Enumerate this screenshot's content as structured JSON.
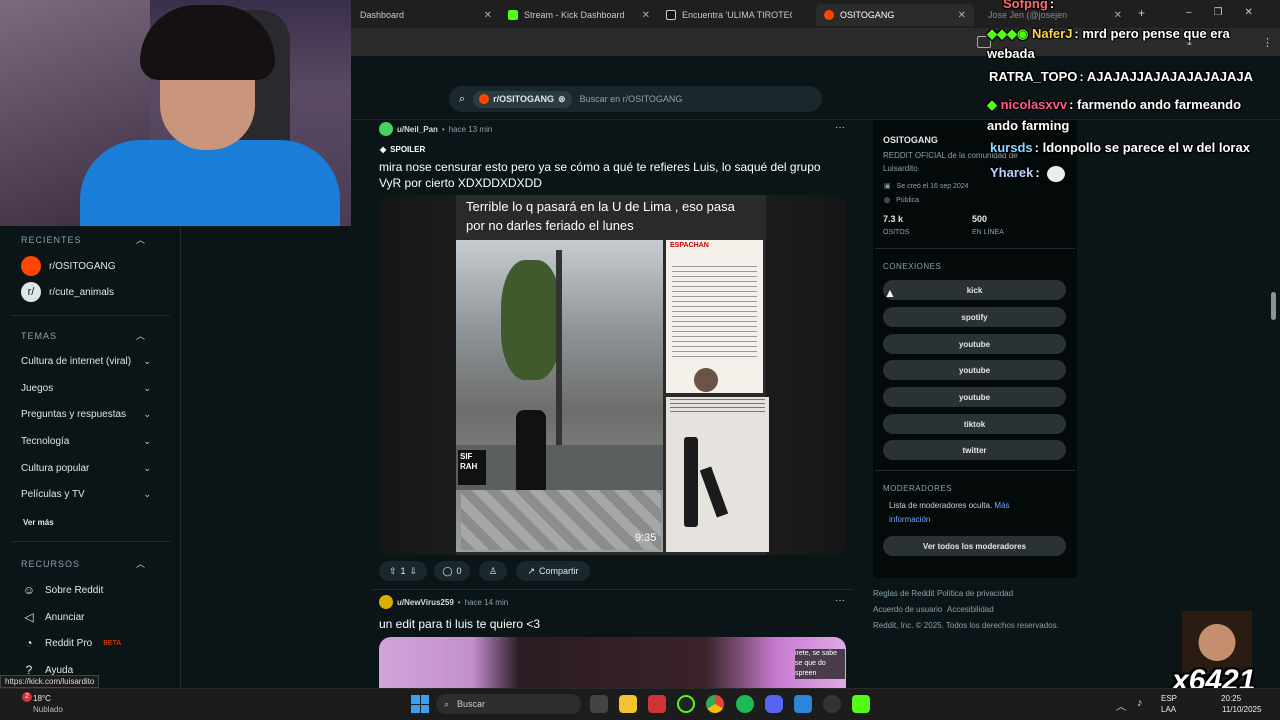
{
  "browser": {
    "tabs": [
      {
        "title": "Dashboard",
        "favicon_color": "#3a3a3a"
      },
      {
        "title": "Stream - Kick Dashboard",
        "favicon_color": "#53fc18"
      },
      {
        "title": "Encuentra 'ULIMA TIROTEO' en",
        "favicon_color": "#111111"
      },
      {
        "title": "OSITOGANG",
        "favicon_color": "#ff4500"
      },
      {
        "title": "Jose Jen (@josejen",
        "favicon_color": "#444444"
      }
    ],
    "new_tab": "+",
    "window_controls": [
      "–",
      "❐",
      "✕"
    ]
  },
  "search": {
    "chip": "r/OSITOGANG",
    "placeholder": "Buscar en r/OSITOGANG"
  },
  "sidebar": {
    "recent_title": "RECIENTES",
    "recent": [
      {
        "label": "r/OSITOGANG",
        "color": "#ff4500"
      },
      {
        "label": "r/cute_animals",
        "color": "#e3e6e8"
      }
    ],
    "topics_title": "TEMAS",
    "topics": [
      "Cultura de internet (viral)",
      "Juegos",
      "Preguntas y respuestas",
      "Tecnología",
      "Cultura popular",
      "Películas y TV"
    ],
    "see_more": "Ver más",
    "resources_title": "RECURSOS",
    "resources": [
      {
        "label": "Sobre Reddit",
        "icon": "reddit-icon"
      },
      {
        "label": "Anunciar",
        "icon": "megaphone-icon"
      },
      {
        "label": "Reddit Pro",
        "icon": "pro-icon",
        "badge": "BETA"
      },
      {
        "label": "Ayuda",
        "icon": "help-icon"
      }
    ]
  },
  "post1": {
    "user": "u/Neil_Pan",
    "time": "hace 13 min",
    "spoiler": "SPOILER",
    "title": "mira nose censurar esto pero ya se cómo a qué te refieres Luis, lo saqué del grupo VyR por cierto XDXDDXDXDD",
    "media_caption": "Terrible lo q pasará en la U de Lima , eso pasa por no darles feriado el lunes",
    "media_time": "9:35",
    "news_header": "ESPACHAN",
    "sign_text": "SIF RAH",
    "votes": "1",
    "comments": "0",
    "share": "Compartir"
  },
  "post2": {
    "user": "u/NewVirus259",
    "time": "hace 14 min",
    "title": "un edit para ti luis te quiero <3",
    "overlay_text": "irete, se sabe se que do spreen"
  },
  "community": {
    "name": "OSITOGANG",
    "description": "REDDIT OFICIAL de la comunidad de Luisardito",
    "created": "Se creó el 16 sep 2024",
    "visibility": "Pública",
    "members_value": "7.3 k",
    "members_label": "OSITOS",
    "online_value": "500",
    "online_label": "EN LÍNEA",
    "connections_title": "CONEXIONES",
    "connections": [
      "kick",
      "spotify",
      "youtube",
      "youtube",
      "youtube",
      "tiktok",
      "twitter"
    ],
    "moderators_title": "MODERADORES",
    "moderators_hidden": "Lista de moderadores oculta.",
    "more_info": "Más información",
    "view_all_mods": "Ver todos los moderadores"
  },
  "footer": {
    "links": [
      "Reglas de Reddit",
      "Política de privacidad",
      "Acuerdo de usuario",
      "Accesibilidad"
    ],
    "copyright": "Reddit, Inc. © 2025. Todos los derechos reservados."
  },
  "chat": [
    {
      "name": "Sofpng",
      "message": ":",
      "color": "#ff6b6b"
    },
    {
      "name": "NaferJ",
      "message": ": mrd pero pense que era webada",
      "color": "#ffd54a"
    },
    {
      "name": "RATRA_TOPO",
      "message": ": AJAJAJJAJAJAJAJAJAJA",
      "color": "#ffffff"
    },
    {
      "name": "nicolasxvv",
      "message": ": farmendo ando farmeando ando farming",
      "color": "#ff5c8a"
    },
    {
      "name": "kursds",
      "message": ": ldonpollo se parece el w del lorax",
      "color": "#8fd6ff"
    },
    {
      "name": "Yharek",
      "message": ":",
      "color": "#bcd2ff"
    }
  ],
  "status_url": "https://kick.com/luisardito",
  "overlay_tag": "x6421",
  "taskbar": {
    "weather_temp": "18°C",
    "weather_desc": "Nublado",
    "weather_badge": "2",
    "search_placeholder": "Buscar",
    "lang": "ESP",
    "lang_sub": "LAA",
    "time": "20:25",
    "date": "11/10/2025"
  },
  "colors": {
    "accent": "#ff4500",
    "kick_green": "#53fc18",
    "background": "#0b1416"
  }
}
